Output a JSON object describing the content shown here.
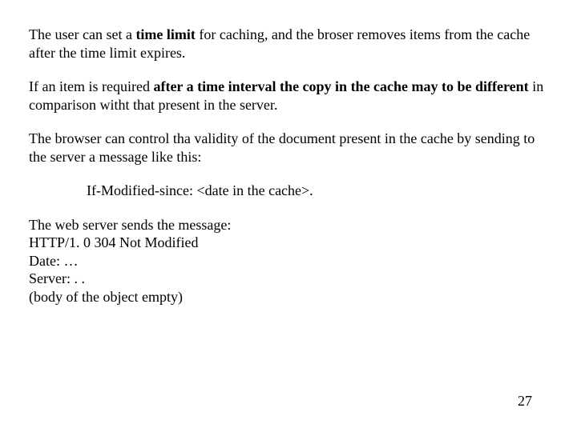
{
  "p1": {
    "a": "The user can set a ",
    "b": "time limit",
    "c": " for caching, and the broser removes items from the cache after the time limit expires."
  },
  "p2": {
    "a": "If an item is required ",
    "b": "after a time interval the copy in the cache may to be different",
    "c": " in comparison witht that present in the server."
  },
  "p3": "The  browser can control tha validity of the document present in the cache by sending to the server a message like this:",
  "p4": "If-Modified-since: <date in the cache>.",
  "p5_l1": "The web server sends the message:",
  "p5_l2": "HTTP/1. 0  304 Not Modified",
  "p5_l3": "Date: …",
  "p5_l4": "Server: . .",
  "p5_l5": "(body of the object empty)",
  "page_number": "27"
}
